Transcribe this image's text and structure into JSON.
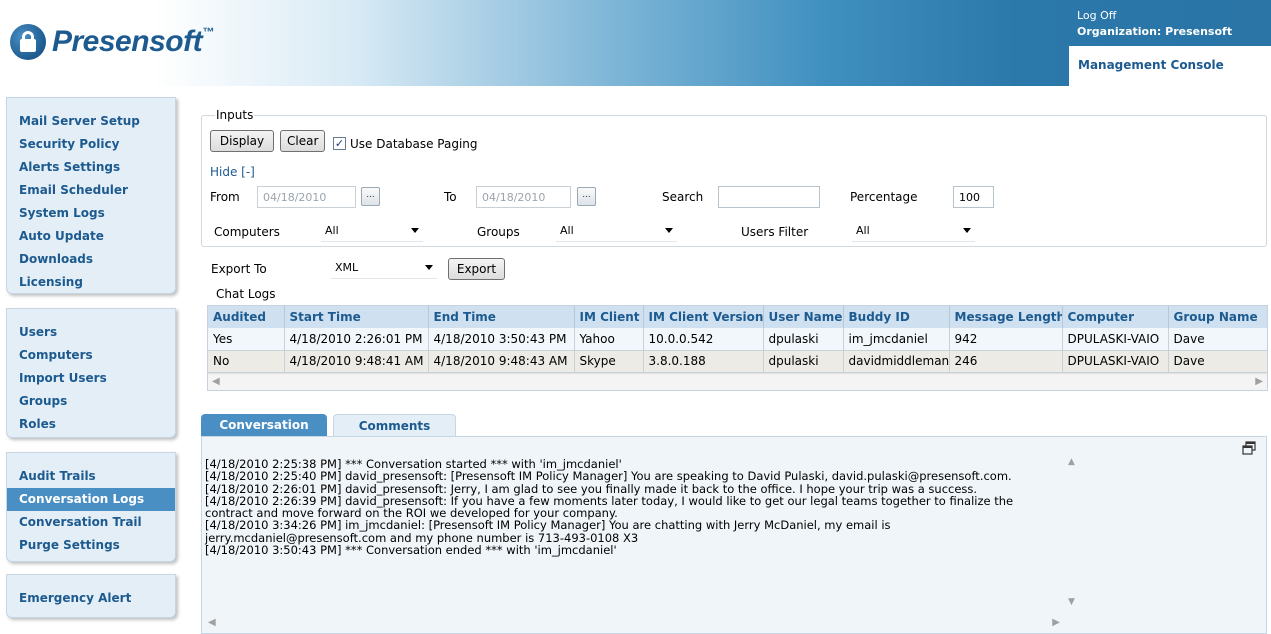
{
  "header": {
    "logo_text": "Presensoft",
    "logo_tm": "™",
    "logoff": "Log Off",
    "organization": "Organization: Presensoft",
    "active_tab": "Management Console"
  },
  "sidebar": {
    "group1": [
      "Mail Server Setup",
      "Security Policy",
      "Alerts Settings",
      "Email Scheduler",
      "System Logs",
      "Auto Update",
      "Downloads",
      "Licensing"
    ],
    "group2": [
      "Users",
      "Computers",
      "Import Users",
      "Groups",
      "Roles"
    ],
    "group3": [
      "Audit Trails",
      "Conversation Logs",
      "Conversation Trail",
      "Purge Settings"
    ],
    "group4": [
      "Emergency Alert"
    ],
    "active_item": "Conversation Logs"
  },
  "inputs": {
    "legend": "Inputs",
    "display_label": "Display",
    "clear_label": "Clear",
    "use_db_paging_label": "Use Database Paging",
    "use_db_paging_checked": true,
    "hide_link": "Hide [-]",
    "from_label": "From",
    "from_value": "04/18/2010",
    "to_label": "To",
    "to_value": "04/18/2010",
    "picker_glyph": "...",
    "search_label": "Search",
    "search_value": "",
    "percentage_label": "Percentage",
    "percentage_value": "100",
    "computers_label": "Computers",
    "computers_value": "All",
    "groups_label": "Groups",
    "groups_value": "All",
    "users_filter_label": "Users Filter",
    "users_filter_value": "All",
    "export_to_label": "Export To",
    "export_format": "XML",
    "export_label": "Export"
  },
  "chat_logs": {
    "legend": "Chat Logs",
    "columns": [
      "Audited",
      "Start Time",
      "End Time",
      "IM Client",
      "IM Client Version",
      "User Name",
      "Buddy ID",
      "Message Length",
      "Computer",
      "Group Name"
    ],
    "rows": [
      [
        "Yes",
        "4/18/2010 2:26:01 PM",
        "4/18/2010 3:50:43 PM",
        "Yahoo",
        "10.0.0.542",
        "dpulaski",
        "im_jmcdaniel",
        "942",
        "DPULASKI-VAIO",
        "Dave"
      ],
      [
        "No",
        "4/18/2010 9:48:41 AM",
        "4/18/2010 9:48:43 AM",
        "Skype",
        "3.8.0.188",
        "dpulaski",
        "davidmiddleman",
        "246",
        "DPULASKI-VAIO",
        "Dave"
      ]
    ]
  },
  "tabs": {
    "conversation": "Conversation",
    "comments": "Comments"
  },
  "conversation": {
    "lines": [
      "[4/18/2010 2:25:38 PM] *** Conversation started *** with 'im_jmcdaniel'",
      "[4/18/2010 2:25:40 PM] david_presensoft: [Presensoft IM Policy Manager] You are speaking to David Pulaski, david.pulaski@presensoft.com.",
      "[4/18/2010 2:26:01 PM] david_presensoft: Jerry, I am glad to see you finally made it back to the office. I hope your trip was a success.",
      "[4/18/2010 2:26:39 PM] david_presensoft: If you have a few moments later today, I would like to get our legal teams together to finalize the",
      "contract and move forward on the ROI we developed for your company.",
      "[4/18/2010 3:34:26 PM] im_jmcdaniel: [Presensoft IM Policy Manager] You are chatting with Jerry McDaniel, my email is",
      "jerry.mcdaniel@presensoft.com and my phone number is 713-493-0108 X3",
      "[4/18/2010 3:50:43 PM] *** Conversation ended *** with 'im_jmcdaniel'"
    ]
  }
}
